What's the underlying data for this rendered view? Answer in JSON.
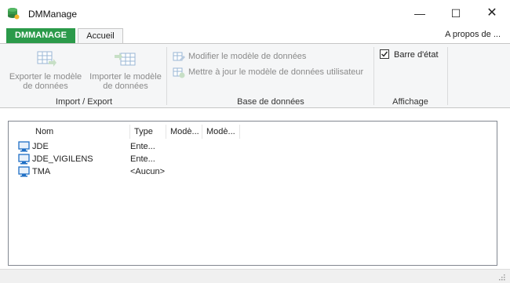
{
  "window": {
    "title": "DMManage",
    "minimize": "—",
    "maximize": "☐",
    "close": "✕"
  },
  "ribbon_tabs": {
    "file": "DMMANAGE",
    "home": "Accueil",
    "about": "A propos de ..."
  },
  "groups": {
    "import_export": {
      "label": "Import / Export",
      "export_label_1": "Exporter le modèle",
      "export_label_2": "de données",
      "import_label_1": "Importer le modèle",
      "import_label_2": "de données"
    },
    "database": {
      "label": "Base de données",
      "modify": "Modifier le modèle de données",
      "update": "Mettre à jour le modèle de données utilisateur"
    },
    "display": {
      "label": "Affichage",
      "status_bar": "Barre d'état",
      "status_bar_checked": true
    }
  },
  "list": {
    "columns": [
      "Nom",
      "Type",
      "Modè...",
      "Modè..."
    ],
    "rows": [
      {
        "name": "JDE",
        "type": "Ente..."
      },
      {
        "name": "JDE_VIGILENS",
        "type": "Ente..."
      },
      {
        "name": "TMA",
        "type": "<Aucun>"
      }
    ]
  },
  "colors": {
    "file_tab": "#2b9a4a",
    "ribbon_bg": "#f5f6f7",
    "icon_blue": "#1f6fc5"
  }
}
